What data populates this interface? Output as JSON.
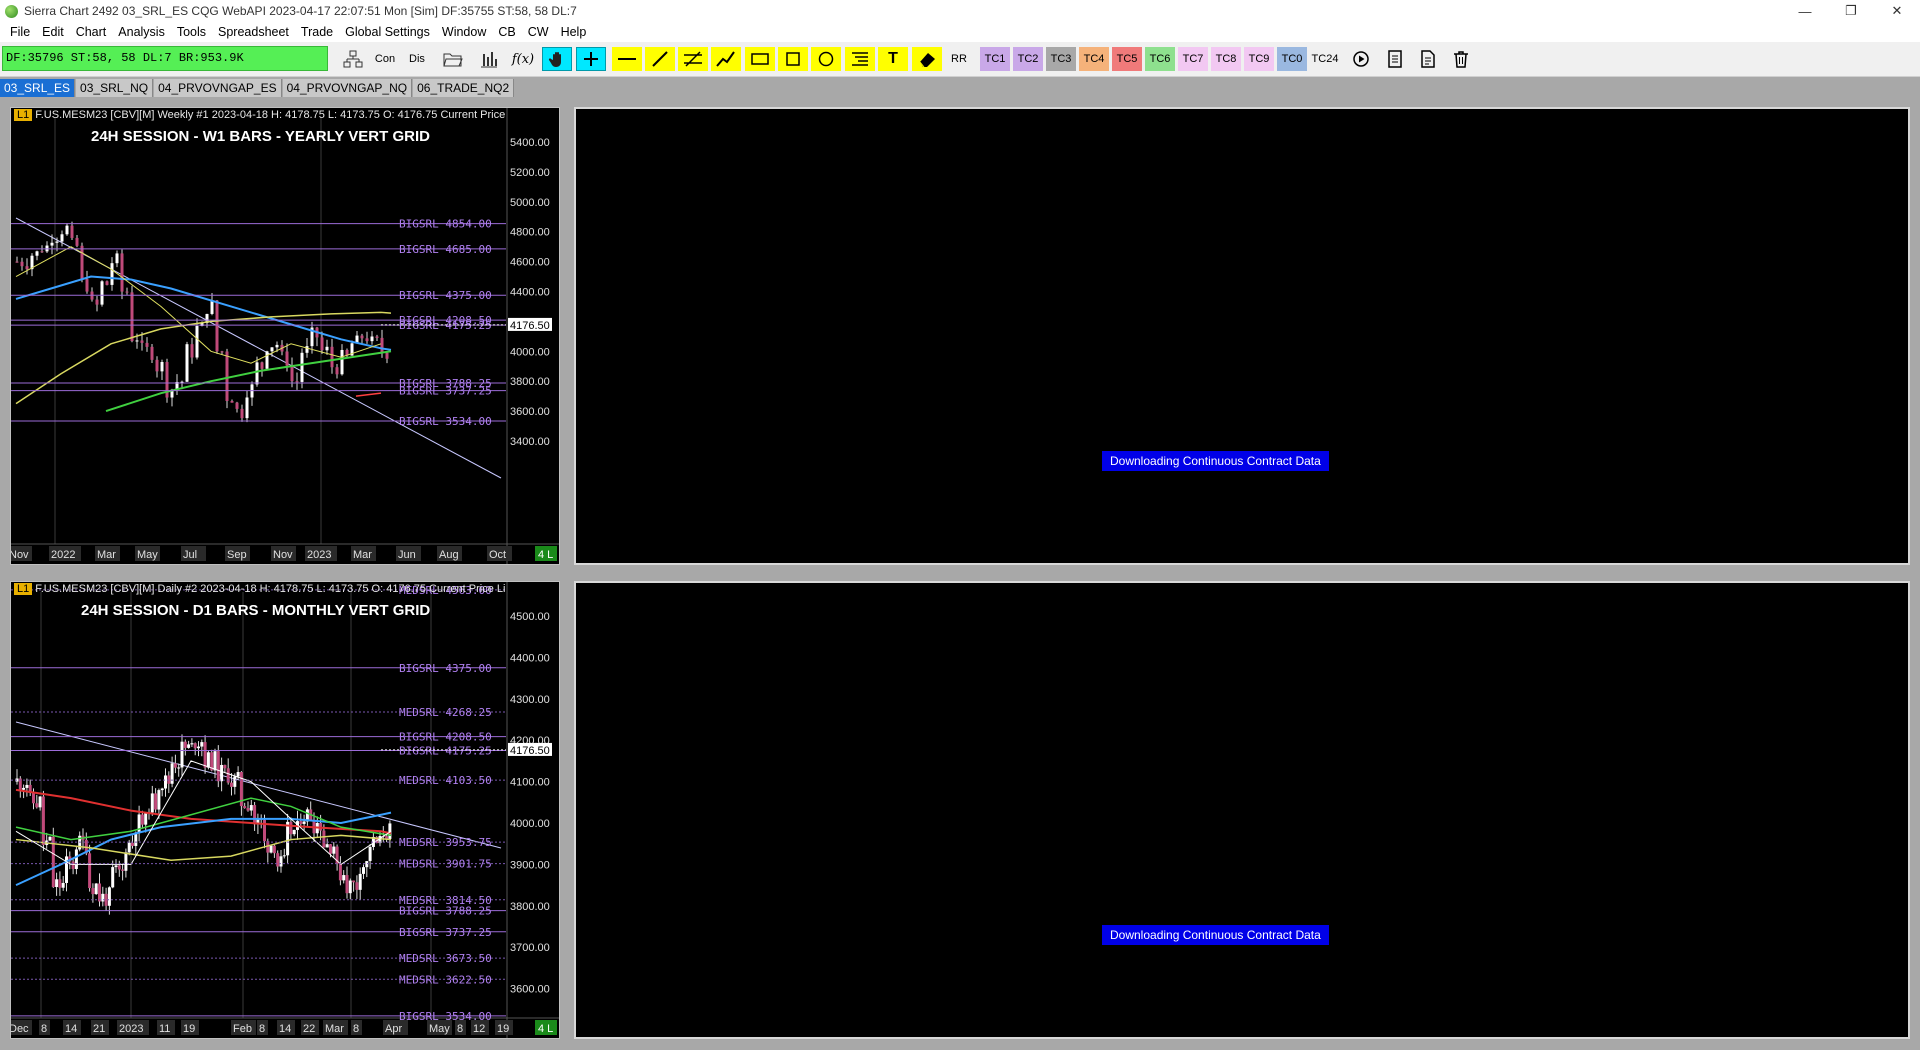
{
  "window": {
    "title": "Sierra Chart 2492 03_SRL_ES  CQG WebAPI 2023-04-17  22:07:51 Mon [Sim]  DF:35755  ST:58, 58  DL:7",
    "controls": [
      "—",
      "❐",
      "✕"
    ]
  },
  "menu": [
    "File",
    "Edit",
    "Chart",
    "Analysis",
    "Tools",
    "Spreadsheet",
    "Trade",
    "Global Settings",
    "Window",
    "CB",
    "CW",
    "Help"
  ],
  "status_box": "DF:35796  ST:58, 58  DL:7  BR:953.9K",
  "toolbar": {
    "con": "Con",
    "dis": "Dis",
    "fx": "f(x)",
    "text_tool": "T",
    "rr": "RR",
    "tc_buttons": [
      {
        "label": "TC1",
        "color": "#c9a8e8"
      },
      {
        "label": "TC2",
        "color": "#c9a8e8"
      },
      {
        "label": "TC3",
        "color": "#a8a8a8"
      },
      {
        "label": "TC4",
        "color": "#f5b27a"
      },
      {
        "label": "TC5",
        "color": "#f07a7a"
      },
      {
        "label": "TC6",
        "color": "#8ee08e"
      },
      {
        "label": "TC7",
        "color": "#f2c8f2"
      },
      {
        "label": "TC8",
        "color": "#f2c8f2"
      },
      {
        "label": "TC9",
        "color": "#f2c8f2"
      },
      {
        "label": "TC0",
        "color": "#9ab8e0"
      },
      {
        "label": "TC24",
        "color": "#f0f0f0"
      }
    ]
  },
  "tabs": [
    "03_SRL_ES",
    "03_SRL_NQ",
    "04_PRVOVNGAP_ES",
    "04_PRVOVNGAP_NQ",
    "06_TRADE_NQ2"
  ],
  "downloading_message": "Downloading Continuous Contract Data",
  "chart1": {
    "badge": "L1",
    "header": "F.US.MESM23 [CBV][M]  Weekly  #1 2023-04-18 H: 4178.75 L: 4173.75 O: 4176.75 Current Price",
    "title": "24H SESSION - W1 BARS - YEARLY VERT GRID",
    "price_labels": [
      "5400.00",
      "5200.00",
      "5000.00",
      "4800.00",
      "4600.00",
      "4400.00",
      "4200.00",
      "4000.00",
      "3800.00",
      "3600.00",
      "3400.00"
    ],
    "srl": [
      {
        "text": "BIGSRL   4854.00"
      },
      {
        "text": "BIGSRL   4685.00"
      },
      {
        "text": "BIGSRL   4375.00"
      },
      {
        "text": "BIGSRL   4208.50"
      },
      {
        "text": "BIGSRL   4175.25"
      },
      {
        "text": "BIGSRL   3788.25"
      },
      {
        "text": "BIGSRL   3737.25"
      },
      {
        "text": "BIGSRL   3534.00"
      }
    ],
    "current_price": "4176.50",
    "x_labels": [
      "Nov",
      "2022",
      "Mar",
      "May",
      "Jul",
      "Sep",
      "Nov",
      "2023",
      "Mar",
      "Jun",
      "Aug",
      "Oct"
    ],
    "corner": "4 L"
  },
  "chart2": {
    "badge": "L1",
    "header": "F.US.MESM23 [CBV][M]  Daily  #2 2023-04-18 H: 4178.75 L: 4173.75 O: 4176.75 Current Price Li",
    "title": "24H SESSION - D1 BARS - MONTHLY VERT GRID",
    "price_labels": [
      "4500.00",
      "4400.00",
      "4300.00",
      "4200.00",
      "4100.00",
      "4000.00",
      "3900.00",
      "3800.00",
      "3700.00",
      "3600.00"
    ],
    "srl": [
      {
        "text": "MEDSRL   4563.00"
      },
      {
        "text": "BIGSRL   4375.00"
      },
      {
        "text": "MEDSRL   4268.25"
      },
      {
        "text": "BIGSRL   4208.50"
      },
      {
        "text": "BIGSRL   4175.25"
      },
      {
        "text": "MEDSRL   4103.50"
      },
      {
        "text": "MEDSRL   3953.75"
      },
      {
        "text": "MEDSRL   3901.75"
      },
      {
        "text": "MEDSRL   3814.50"
      },
      {
        "text": "BIGSRL   3788.25"
      },
      {
        "text": "BIGSRL   3737.25"
      },
      {
        "text": "MEDSRL   3673.50"
      },
      {
        "text": "MEDSRL   3622.50"
      },
      {
        "text": "BIGSRL   3534.00"
      }
    ],
    "current_price": "4176.50",
    "x_labels": [
      "Dec",
      "8",
      "14",
      "21",
      "2023",
      "11",
      "19",
      "Feb",
      "8",
      "14",
      "22",
      "Mar",
      "8",
      "Apr",
      "May",
      "8",
      "12",
      "19"
    ],
    "corner": "4 L"
  }
}
